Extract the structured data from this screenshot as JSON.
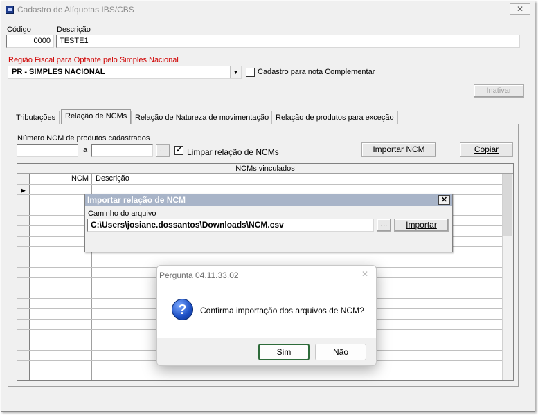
{
  "window": {
    "title": "Cadastro de Alíquotas IBS/CBS",
    "close_glyph": "✕"
  },
  "codigo": {
    "label": "Código",
    "value": "0000"
  },
  "descricao": {
    "label": "Descrição",
    "value": "TESTE1"
  },
  "regiao": {
    "label": "Região Fiscal para Optante pelo Simples Nacional",
    "value": "PR - SIMPLES NACIONAL",
    "label_color": "#d00000"
  },
  "complementar": {
    "label": "Cadastro para nota Complementar",
    "checked": false
  },
  "inativar_label": "Inativar",
  "tabs": [
    {
      "label": "Tributações"
    },
    {
      "label": "Relação de NCMs"
    },
    {
      "label": "Relação de Natureza de movimentação"
    },
    {
      "label": "Relação de produtos para exceção"
    }
  ],
  "ncm_tab": {
    "range_label": "Número  NCM de produtos cadastrados",
    "range_sep": "a",
    "from_value": "",
    "to_value": "",
    "browse_label": "...",
    "limpar_label": "Limpar relação de NCMs",
    "limpar_checked": true,
    "importar_label": "Importar NCM",
    "copiar_label": "Copiar",
    "grid": {
      "title": "NCMs vinculados",
      "columns": [
        "NCM",
        "Descrição"
      ],
      "rows": []
    }
  },
  "import_dialog": {
    "title": "Importar relação de NCM",
    "close_glyph": "✕",
    "path_label": "Caminho do arquivo",
    "path_value": "C:\\Users\\josiane.dossantos\\Downloads\\NCM.csv",
    "browse_label": "...",
    "importar_label": "Importar"
  },
  "question_dialog": {
    "title": "Pergunta 04.11.33.02",
    "close_glyph": "✕",
    "icon_glyph": "?",
    "message": "Confirma importação dos arquivos de NCM?",
    "yes_label": "Sim",
    "no_label": "Não"
  }
}
